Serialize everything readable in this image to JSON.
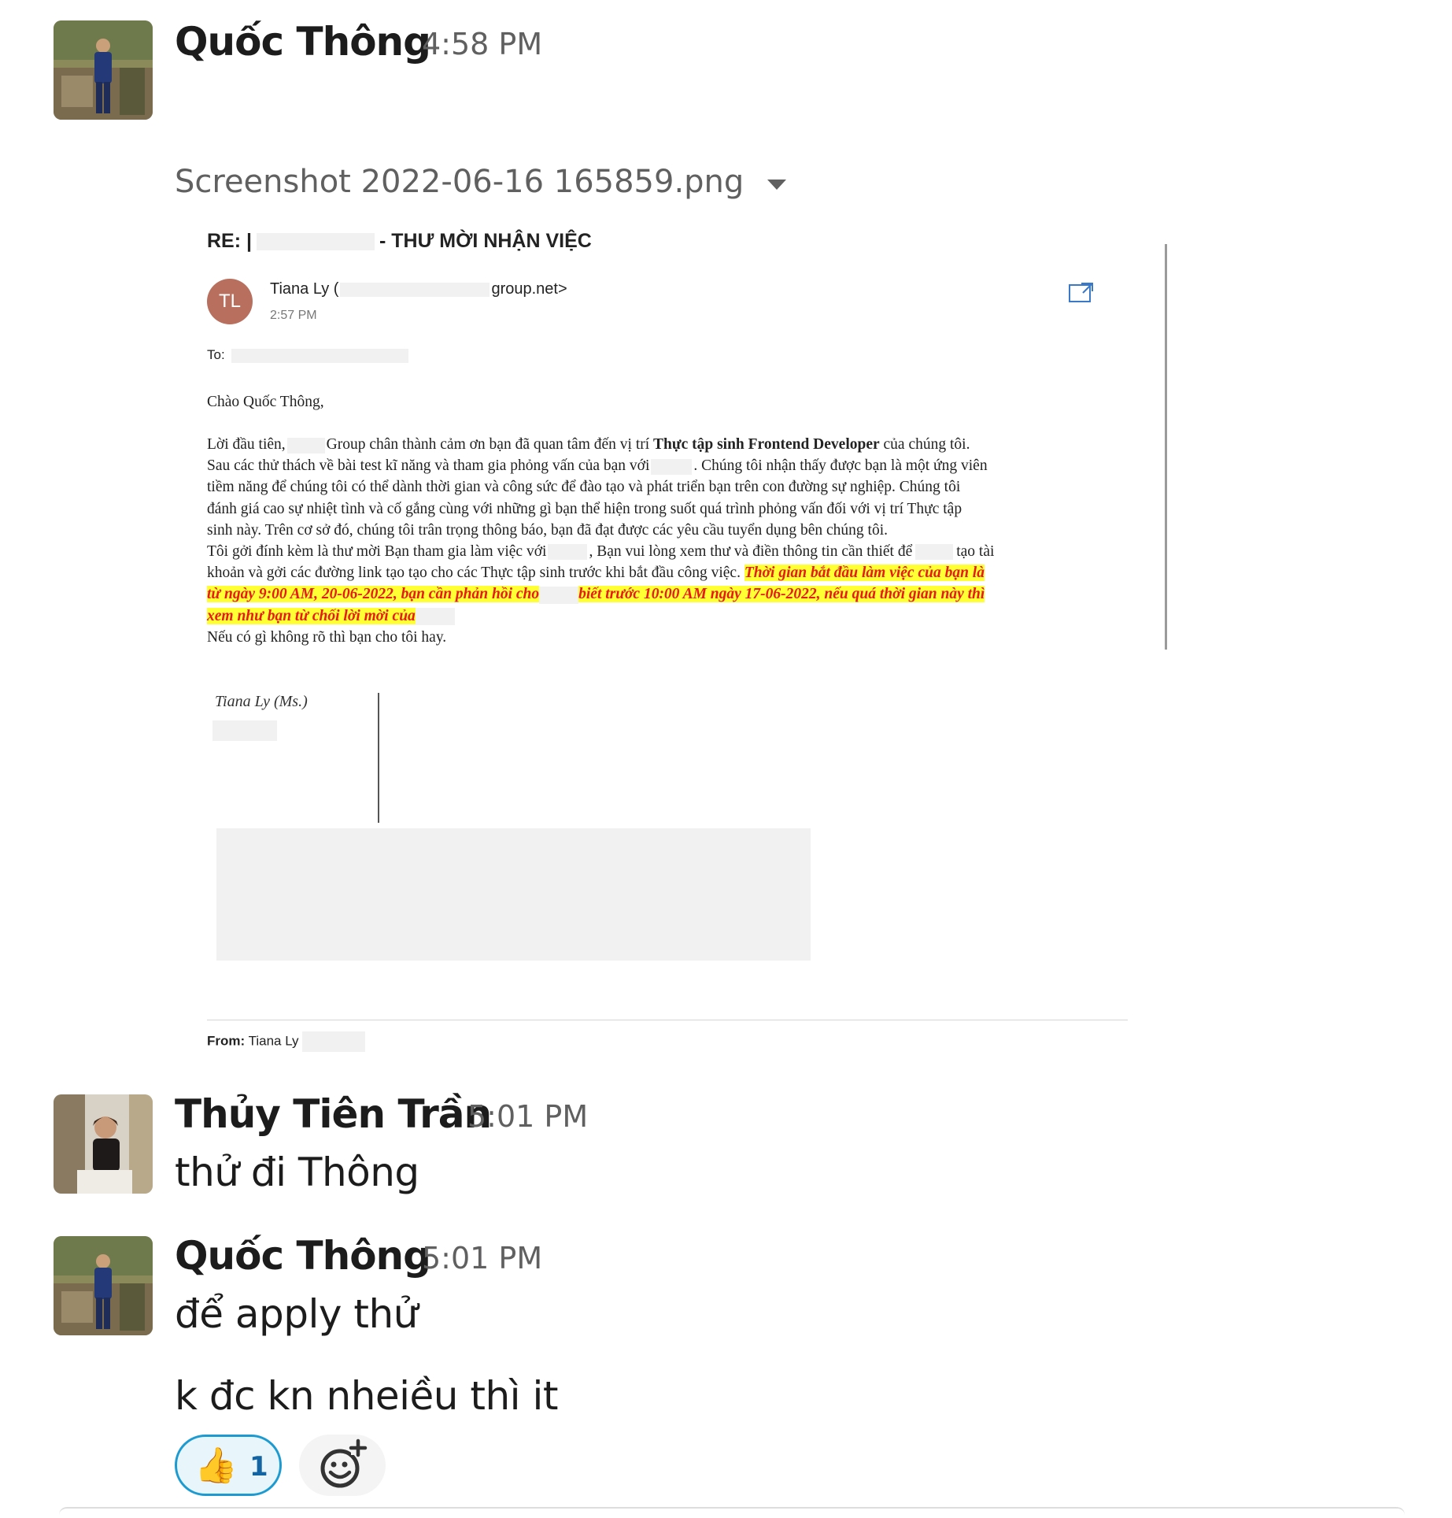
{
  "messages": [
    {
      "sender": "Quốc Thông",
      "time": "4:58 PM",
      "attachment": {
        "filename": "Screenshot 2022-06-16 165859.png",
        "email": {
          "subject_prefix": "RE: |",
          "subject_suffix": "- THƯ MỜI NHẬN VIỆC",
          "avatar_initials": "TL",
          "from_name": "Tiana Ly (",
          "from_domain": "group.net>",
          "time": "2:57 PM",
          "to_label": "To:",
          "greeting": "Chào Quốc Thông,",
          "p1": "Lời đầu tiên,",
          "p1b": "Group chân thành cảm ơn bạn đã quan tâm đến vị trí",
          "p1_bold": "Thực tập sinh Frontend Developer",
          "p1c": "của chúng tôi.",
          "l2a": "Sau các thử thách về bài test kĩ năng và tham gia phỏng vấn của bạn với",
          "l2b": ". Chúng tôi nhận thấy được bạn là một ứng viên",
          "l3": "tiềm năng để chúng tôi có thể  dành thời gian và công sức để đào tạo và phát triển bạn trên con đường sự nghiệp.  Chúng tôi",
          "l4": "đánh giá cao sự nhiệt tình và cố gắng cùng với những gì bạn thể hiện trong suốt quá trình phỏng vấn đối với vị trí Thực tập",
          "l5": "sinh này. Trên cơ sở đó, chúng tôi trân trọng thông báo, bạn đã đạt được các yêu cầu tuyển dụng bên chúng tôi.",
          "l6a": "Tôi gởi đính kèm là thư mời Bạn tham gia làm việc với",
          "l6b": ", Bạn vui lòng xem thư và điền thông tin cần thiết để",
          "l6c": "tạo tài",
          "l7a": "khoản và gởi các đường link tạo tạo cho các Thực tập sinh trước khi bắt đầu công việc.",
          "l7_hl": "Thời gian bắt đầu làm việc của bạn là",
          "l8_hl_a": "từ ngày 9:00 AM, 20-06-2022, bạn cần phản hồi cho",
          "l8_hl_b": "biết trước 10:00 AM ngày 17-06-2022, nếu quá thời gian này thì",
          "l9_hl": "xem như bạn từ chối lời mời của",
          "l10": "Nếu có gì không rõ thì bạn cho tôi hay.",
          "signature": "Tiana Ly (Ms.)",
          "footer_from_label": "From:",
          "footer_from_name": "Tiana Ly"
        }
      }
    },
    {
      "sender": "Thủy Tiên Trần",
      "time": "5:01 PM",
      "text": "thử   đi Thông"
    },
    {
      "sender": "Quốc Thông",
      "time": "5:01 PM",
      "text": "để apply thử",
      "text2": "k đc kn nheiều thì it",
      "reaction": {
        "emoji": "👍",
        "count": "1"
      }
    }
  ],
  "colors": {
    "reaction_border": "#1d9bd1",
    "highlight_bg": "#ffff33",
    "highlight_text": "#e31b1b",
    "avatar_tl": "#b86f5e"
  },
  "icons": [
    "caret-down-icon",
    "popout-icon",
    "thumbs-up-icon",
    "add-reaction-icon"
  ]
}
